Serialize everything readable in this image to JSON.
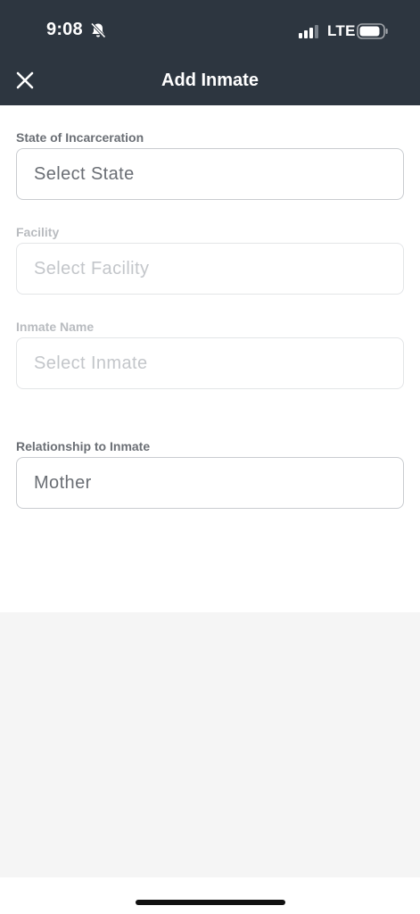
{
  "status_bar": {
    "time": "9:08",
    "network": "LTE"
  },
  "nav": {
    "title": "Add Inmate"
  },
  "form": {
    "state": {
      "label": "State of Incarceration",
      "value": "Select State",
      "enabled": true
    },
    "facility": {
      "label": "Facility",
      "value": "Select Facility",
      "enabled": false
    },
    "inmate": {
      "label": "Inmate Name",
      "value": "Select Inmate",
      "enabled": false
    },
    "relationship": {
      "label": "Relationship to Inmate",
      "value": "Mother",
      "enabled": true
    }
  },
  "colors": {
    "header_bg": "#2d3640",
    "label": "#6b6f75",
    "label_disabled": "#b9bcc0",
    "field_border": "#c9ccd0",
    "panel_bg": "#f5f5f5"
  },
  "icons": {
    "close": "close-icon",
    "silent": "bell-slash-icon",
    "signal": "cellular-signal-icon",
    "battery": "battery-icon"
  }
}
